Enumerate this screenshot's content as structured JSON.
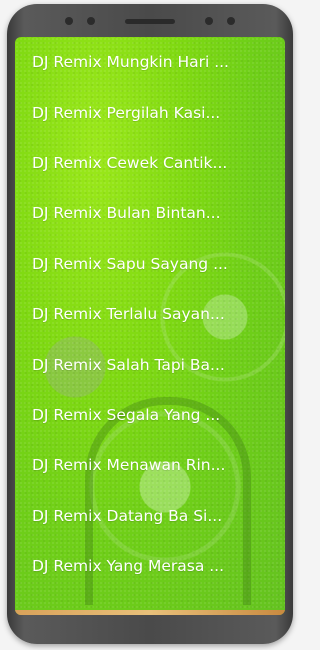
{
  "songs": [
    {
      "label": "DJ Remix Mungkin Hari ..."
    },
    {
      "label": "DJ Remix Pergilah Kasi..."
    },
    {
      "label": "DJ Remix Cewek Cantik..."
    },
    {
      "label": "DJ Remix Bulan Bintan..."
    },
    {
      "label": "DJ Remix Sapu Sayang ..."
    },
    {
      "label": "DJ Remix Terlalu Sayan..."
    },
    {
      "label": "DJ Remix Salah Tapi Ba..."
    },
    {
      "label": "DJ Remix Segala Yang ..."
    },
    {
      "label": "DJ Remix Menawan Rin..."
    },
    {
      "label": "DJ Remix Datang Ba Si..."
    },
    {
      "label": "DJ Remix Yang Merasa ..."
    }
  ],
  "colors": {
    "background": "#7fd912",
    "text": "#ffffff",
    "frame": "#4a4a4a"
  }
}
